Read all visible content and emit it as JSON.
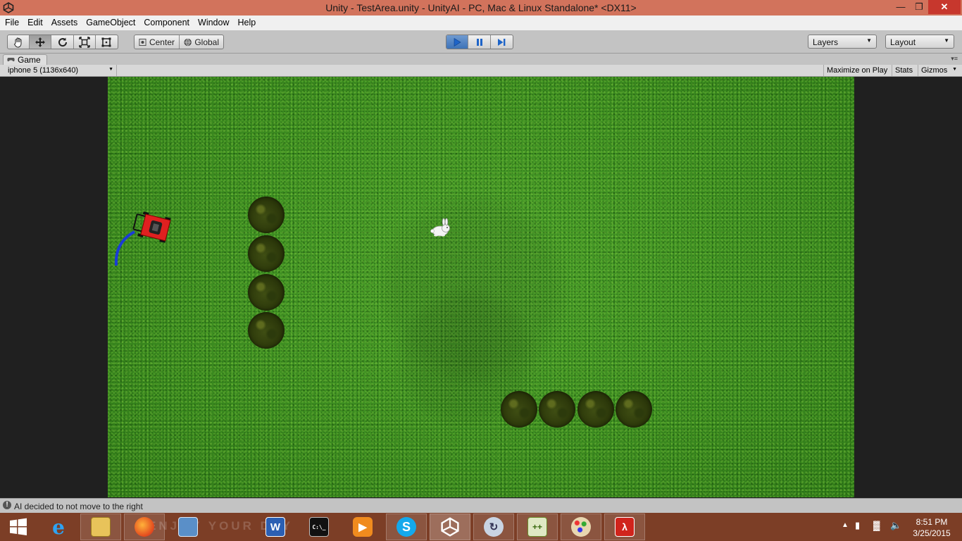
{
  "window": {
    "title": "Unity - TestArea.unity - UnityAI - PC, Mac & Linux Standalone* <DX11>",
    "minimize": "—",
    "maximize": "❐",
    "close": "✕"
  },
  "menu": [
    "File",
    "Edit",
    "Assets",
    "GameObject",
    "Component",
    "Window",
    "Help"
  ],
  "toolbar": {
    "tools": [
      "hand-tool",
      "move-tool",
      "rotate-tool",
      "scale-tool",
      "rect-tool"
    ],
    "active_tool": "move-tool",
    "pivot_label": "Center",
    "space_label": "Global",
    "play_state": "playing",
    "layers_label": "Layers",
    "layout_label": "Layout"
  },
  "game_view": {
    "tab_label": "Game",
    "aspect_label": "iphone 5 (1136x640)",
    "maximize_on_play": "Maximize on Play",
    "stats": "Stats",
    "gizmos": "Gizmos"
  },
  "scene": {
    "objects": [
      "lawnmower",
      "bunny",
      "bush",
      "bush",
      "bush",
      "bush",
      "bush",
      "bush",
      "bush",
      "bush"
    ],
    "colors": {
      "grass": "#3e8f22",
      "mower": "#e02020",
      "mower_path": "#1a3bd6",
      "bush": "#2f3b0c"
    }
  },
  "console": {
    "message": "AI decided to not move to the right"
  },
  "taskbar": {
    "apps": [
      "internet-explorer",
      "file-explorer",
      "firefox",
      "network-app",
      "word",
      "command-prompt",
      "media-player",
      "skype",
      "unity",
      "remote-desktop",
      "notepad-plus-plus",
      "paint",
      "acrobat"
    ],
    "watermark": "ENJOY YOUR DAY",
    "time": "8:51 PM",
    "date": "3/25/2015"
  }
}
